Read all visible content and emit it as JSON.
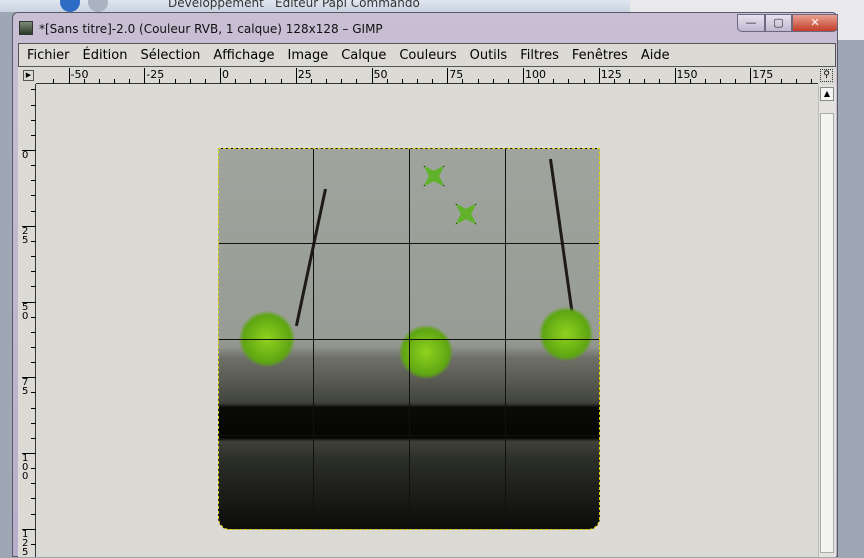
{
  "explorer": {
    "breadcrumbs": [
      "Développement",
      "Editeur Papi Commando"
    ]
  },
  "window": {
    "title": "*[Sans titre]-2.0 (Couleur RVB, 1 calque) 128x128 – GIMP",
    "minimize": "—",
    "maximize": "▢",
    "close": "✕"
  },
  "menu": [
    "Fichier",
    "Édition",
    "Sélection",
    "Affichage",
    "Image",
    "Calque",
    "Couleurs",
    "Outils",
    "Filtres",
    "Fenêtres",
    "Aide"
  ],
  "hruler": [
    "-50",
    "-25",
    "0",
    "25",
    "50",
    "75",
    "100",
    "125",
    "150",
    "175"
  ],
  "vruler": [
    "0",
    "25",
    "50",
    "75",
    "100",
    "125"
  ],
  "icons": {
    "ruler_menu": "triangle-right-icon",
    "zoom": "magnifier-icon",
    "scroll_up": "arrow-up-icon"
  }
}
